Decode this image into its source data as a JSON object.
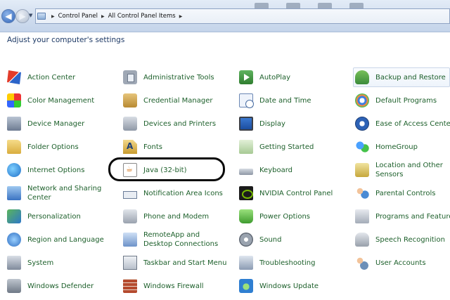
{
  "address_bar": {
    "crumbs": [
      "Control Panel",
      "All Control Panel Items"
    ]
  },
  "heading": "Adjust your computer's settings",
  "columns": [
    [
      {
        "label": "Action Center",
        "icon": "action-center-icon"
      },
      {
        "label": "Color Management",
        "icon": "color-management-icon"
      },
      {
        "label": "Device Manager",
        "icon": "device-manager-icon"
      },
      {
        "label": "Folder Options",
        "icon": "folder-options-icon"
      },
      {
        "label": "Internet Options",
        "icon": "internet-options-icon"
      },
      {
        "label": "Network and Sharing Center",
        "icon": "network-icon"
      },
      {
        "label": "Personalization",
        "icon": "personalization-icon"
      },
      {
        "label": "Region and Language",
        "icon": "region-icon"
      },
      {
        "label": "System",
        "icon": "system-icon"
      },
      {
        "label": "Windows Defender",
        "icon": "defender-icon"
      }
    ],
    [
      {
        "label": "Administrative Tools",
        "icon": "admin-tools-icon"
      },
      {
        "label": "Credential Manager",
        "icon": "credential-manager-icon"
      },
      {
        "label": "Devices and Printers",
        "icon": "printer-icon"
      },
      {
        "label": "Fonts",
        "icon": "fonts-icon"
      },
      {
        "label": "Java (32-bit)",
        "icon": "java-icon"
      },
      {
        "label": "Notification Area Icons",
        "icon": "notification-area-icon"
      },
      {
        "label": "Phone and Modem",
        "icon": "phone-modem-icon"
      },
      {
        "label": "RemoteApp and Desktop Connections",
        "icon": "remoteapp-icon"
      },
      {
        "label": "Taskbar and Start Menu",
        "icon": "taskbar-icon"
      },
      {
        "label": "Windows Firewall",
        "icon": "firewall-icon"
      }
    ],
    [
      {
        "label": "AutoPlay",
        "icon": "autoplay-icon"
      },
      {
        "label": "Date and Time",
        "icon": "date-time-icon"
      },
      {
        "label": "Display",
        "icon": "display-icon"
      },
      {
        "label": "Getting Started",
        "icon": "getting-started-icon"
      },
      {
        "label": "Keyboard",
        "icon": "keyboard-icon"
      },
      {
        "label": "NVIDIA Control Panel",
        "icon": "nvidia-icon"
      },
      {
        "label": "Power Options",
        "icon": "power-options-icon"
      },
      {
        "label": "Sound",
        "icon": "sound-icon"
      },
      {
        "label": "Troubleshooting",
        "icon": "troubleshooting-icon"
      },
      {
        "label": "Windows Update",
        "icon": "windows-update-icon"
      }
    ],
    [
      {
        "label": "Backup and Restore",
        "icon": "backup-icon"
      },
      {
        "label": "Default Programs",
        "icon": "default-programs-icon"
      },
      {
        "label": "Ease of Access Center",
        "icon": "ease-of-access-icon"
      },
      {
        "label": "HomeGroup",
        "icon": "homegroup-icon"
      },
      {
        "label": "Location and Other Sensors",
        "icon": "location-icon"
      },
      {
        "label": "Parental Controls",
        "icon": "parental-controls-icon"
      },
      {
        "label": "Programs and Features",
        "icon": "programs-features-icon"
      },
      {
        "label": "Speech Recognition",
        "icon": "speech-icon"
      },
      {
        "label": "User Accounts",
        "icon": "user-accounts-icon"
      }
    ]
  ]
}
